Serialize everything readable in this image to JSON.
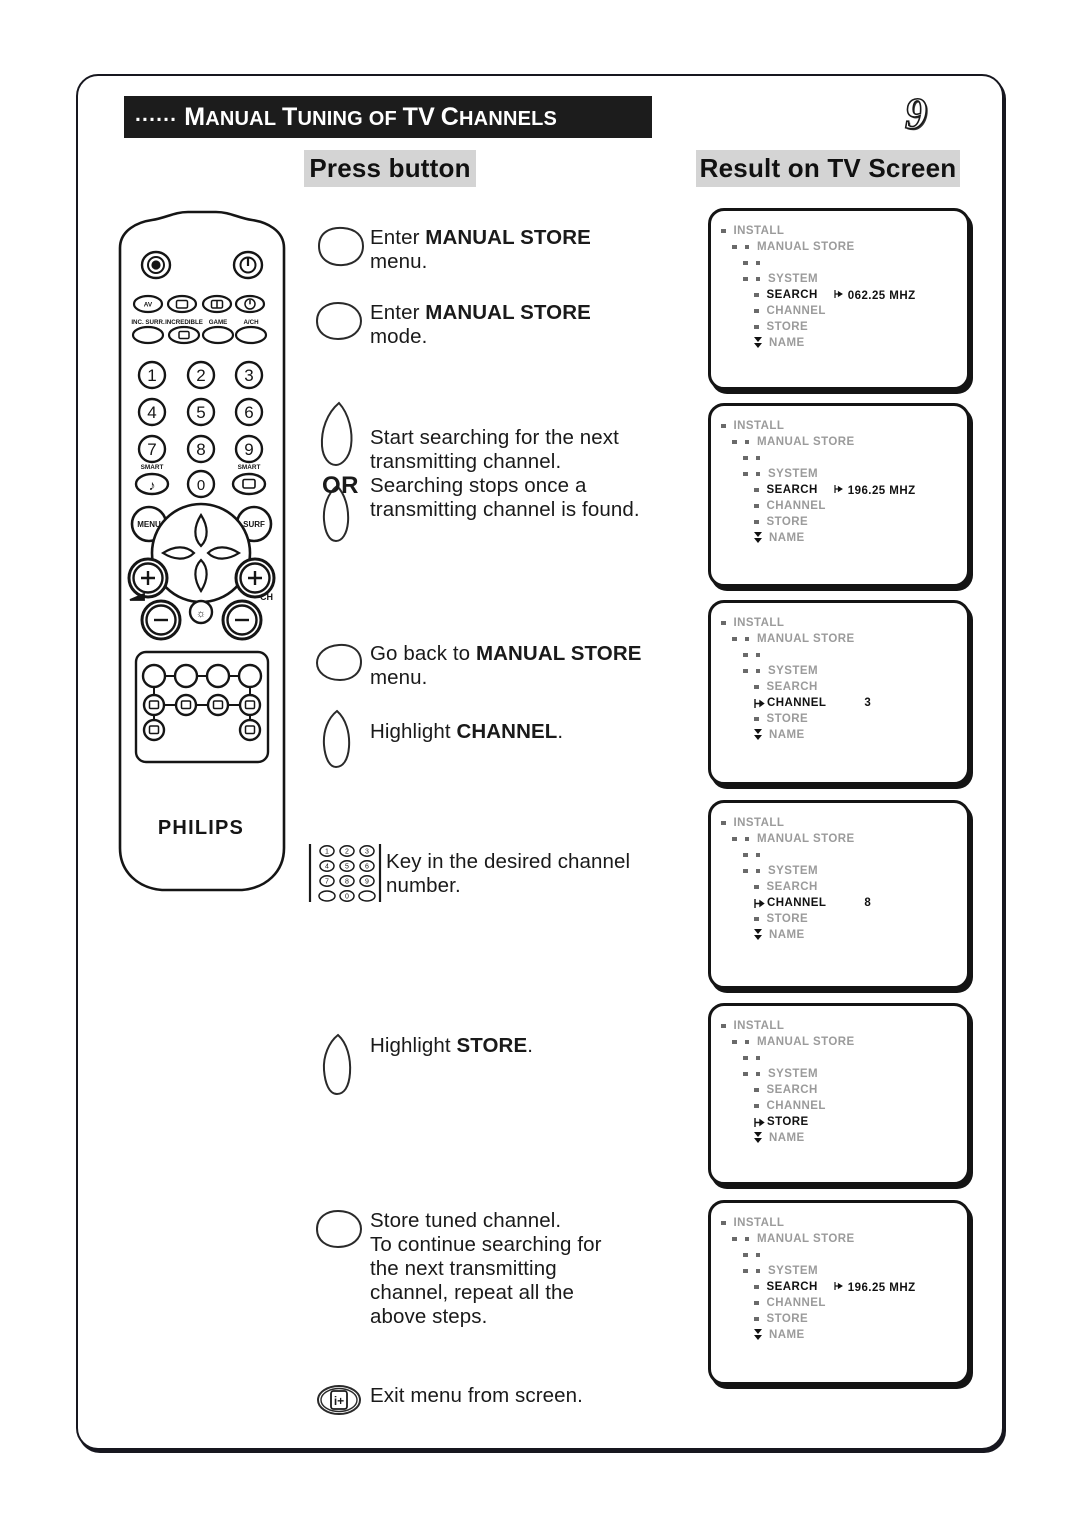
{
  "page": {
    "number": "9",
    "title_dots": "......",
    "title_parts": [
      {
        "big": "M",
        "rest": "ANUAL"
      },
      {
        "big": "T",
        "rest": "UNING"
      },
      {
        "big": "",
        "rest": "OF"
      },
      {
        "big": "TV",
        "rest": ""
      },
      {
        "big": "C",
        "rest": "HANNELS"
      }
    ],
    "title_plain": "...... MANUAL TUNING OF TV CHANNELS"
  },
  "columns": {
    "press_button": "Press button",
    "result_on_tv": "Result on TV Screen"
  },
  "remote": {
    "brand": "PHILIPS",
    "labels": {
      "inc_surr": "INC. SURR.",
      "incredible": "INCREDIBLE",
      "game": "GAME",
      "ach": "A/CH",
      "smart_left": "SMART",
      "smart_right": "SMART",
      "menu": "MENU",
      "surf": "SURF",
      "av": "AV",
      "ch": "CH"
    },
    "numbers": [
      "1",
      "2",
      "3",
      "4",
      "5",
      "6",
      "7",
      "8",
      "9",
      "0"
    ]
  },
  "steps": [
    {
      "id": "enter-manual-store-menu",
      "button_icon": "menu-teardrop-button",
      "lines": [
        {
          "pre": "Enter ",
          "bold": "MANUAL STORE",
          "post": ""
        },
        {
          "pre": "menu.",
          "bold": "",
          "post": ""
        }
      ]
    },
    {
      "id": "enter-manual-store-mode",
      "button_icon": "right-cursor-teardrop-button",
      "lines": [
        {
          "pre": "Enter ",
          "bold": "MANUAL STORE",
          "post": ""
        },
        {
          "pre": "mode.",
          "bold": "",
          "post": ""
        }
      ]
    },
    {
      "id": "start-searching",
      "button_icon": "up-cursor-teardrop-button",
      "button_icon_2": "down-cursor-teardrop-button",
      "or_label": "OR",
      "lines": [
        {
          "pre": "Start searching for the next",
          "bold": "",
          "post": ""
        },
        {
          "pre": "transmitting channel.",
          "bold": "",
          "post": ""
        },
        {
          "pre": "Searching stops once a",
          "bold": "",
          "post": ""
        },
        {
          "pre": "transmitting channel is found.",
          "bold": "",
          "post": ""
        }
      ]
    },
    {
      "id": "go-back-to-manual-store",
      "button_icon": "left-cursor-teardrop-button",
      "lines": [
        {
          "pre": "Go back to ",
          "bold": "MANUAL STORE",
          "post": ""
        },
        {
          "pre": "menu.",
          "bold": "",
          "post": ""
        }
      ]
    },
    {
      "id": "highlight-channel",
      "button_icon": "down-cursor-teardrop-button",
      "lines": [
        {
          "pre": "Highlight ",
          "bold": "CHANNEL",
          "post": "."
        }
      ]
    },
    {
      "id": "key-in-channel-number",
      "button_icon": "numeric-keypad-icon",
      "lines": [
        {
          "pre": "Key in the desired channel",
          "bold": "",
          "post": ""
        },
        {
          "pre": "number.",
          "bold": "",
          "post": ""
        }
      ]
    },
    {
      "id": "highlight-store",
      "button_icon": "down-cursor-teardrop-button",
      "lines": [
        {
          "pre": "Highlight ",
          "bold": "STORE",
          "post": "."
        }
      ]
    },
    {
      "id": "store-tuned-channel",
      "button_icon": "right-cursor-teardrop-button",
      "lines": [
        {
          "pre": "Store tuned channel.",
          "bold": "",
          "post": ""
        },
        {
          "pre": "To continue searching for",
          "bold": "",
          "post": ""
        },
        {
          "pre": "the next transmitting",
          "bold": "",
          "post": ""
        },
        {
          "pre": "channel, repeat all the",
          "bold": "",
          "post": ""
        },
        {
          "pre": "above steps.",
          "bold": "",
          "post": ""
        }
      ]
    },
    {
      "id": "exit-menu",
      "button_icon": "info-plus-button",
      "button_label": "i+",
      "lines": [
        {
          "pre": "Exit menu from screen.",
          "bold": "",
          "post": ""
        }
      ]
    }
  ],
  "tv_screens": [
    {
      "id": "screen-search-062",
      "rows": [
        {
          "label": "INSTALL",
          "indent": 0,
          "marker": "box",
          "selected": false,
          "value": ""
        },
        {
          "label": "MANUAL STORE",
          "indent": 1,
          "marker": "box2",
          "selected": false,
          "value": ""
        },
        {
          "label": "",
          "indent": 2,
          "marker": "box2",
          "selected": false,
          "value": ""
        },
        {
          "label": "SYSTEM",
          "indent": 2,
          "marker": "box2",
          "selected": false,
          "value": ""
        },
        {
          "label": "SEARCH",
          "indent": 3,
          "marker": "box",
          "selected": true,
          "value": "062.25 MHZ"
        },
        {
          "label": "CHANNEL",
          "indent": 3,
          "marker": "box",
          "selected": false,
          "value": ""
        },
        {
          "label": "STORE",
          "indent": 3,
          "marker": "box",
          "selected": false,
          "value": ""
        },
        {
          "label": "NAME",
          "indent": 3,
          "marker": "arrows",
          "selected": false,
          "value": ""
        }
      ]
    },
    {
      "id": "screen-search-196-a",
      "rows": [
        {
          "label": "INSTALL",
          "indent": 0,
          "marker": "box",
          "selected": false,
          "value": ""
        },
        {
          "label": "MANUAL STORE",
          "indent": 1,
          "marker": "box2",
          "selected": false,
          "value": ""
        },
        {
          "label": "",
          "indent": 2,
          "marker": "box2",
          "selected": false,
          "value": ""
        },
        {
          "label": "SYSTEM",
          "indent": 2,
          "marker": "box2",
          "selected": false,
          "value": ""
        },
        {
          "label": "SEARCH",
          "indent": 3,
          "marker": "box",
          "selected": true,
          "value": "196.25 MHZ"
        },
        {
          "label": "CHANNEL",
          "indent": 3,
          "marker": "box",
          "selected": false,
          "value": ""
        },
        {
          "label": "STORE",
          "indent": 3,
          "marker": "box",
          "selected": false,
          "value": ""
        },
        {
          "label": "NAME",
          "indent": 3,
          "marker": "arrows",
          "selected": false,
          "value": ""
        }
      ]
    },
    {
      "id": "screen-channel-3",
      "rows": [
        {
          "label": "INSTALL",
          "indent": 0,
          "marker": "box",
          "selected": false,
          "value": ""
        },
        {
          "label": "MANUAL STORE",
          "indent": 1,
          "marker": "box2",
          "selected": false,
          "value": ""
        },
        {
          "label": "",
          "indent": 2,
          "marker": "box2",
          "selected": false,
          "value": ""
        },
        {
          "label": "SYSTEM",
          "indent": 2,
          "marker": "box2",
          "selected": false,
          "value": ""
        },
        {
          "label": "SEARCH",
          "indent": 3,
          "marker": "box",
          "selected": false,
          "value": ""
        },
        {
          "label": "CHANNEL",
          "indent": 3,
          "marker": "cursor",
          "selected": true,
          "value": "3"
        },
        {
          "label": "STORE",
          "indent": 3,
          "marker": "box",
          "selected": false,
          "value": ""
        },
        {
          "label": "NAME",
          "indent": 3,
          "marker": "arrows",
          "selected": false,
          "value": ""
        }
      ]
    },
    {
      "id": "screen-channel-8",
      "rows": [
        {
          "label": "INSTALL",
          "indent": 0,
          "marker": "box",
          "selected": false,
          "value": ""
        },
        {
          "label": "MANUAL STORE",
          "indent": 1,
          "marker": "box2",
          "selected": false,
          "value": ""
        },
        {
          "label": "",
          "indent": 2,
          "marker": "box2",
          "selected": false,
          "value": ""
        },
        {
          "label": "SYSTEM",
          "indent": 2,
          "marker": "box2",
          "selected": false,
          "value": ""
        },
        {
          "label": "SEARCH",
          "indent": 3,
          "marker": "box",
          "selected": false,
          "value": ""
        },
        {
          "label": "CHANNEL",
          "indent": 3,
          "marker": "cursor",
          "selected": true,
          "value": "8"
        },
        {
          "label": "STORE",
          "indent": 3,
          "marker": "box",
          "selected": false,
          "value": ""
        },
        {
          "label": "NAME",
          "indent": 3,
          "marker": "arrows",
          "selected": false,
          "value": ""
        }
      ]
    },
    {
      "id": "screen-store",
      "rows": [
        {
          "label": "INSTALL",
          "indent": 0,
          "marker": "box",
          "selected": false,
          "value": ""
        },
        {
          "label": "MANUAL STORE",
          "indent": 1,
          "marker": "box2",
          "selected": false,
          "value": ""
        },
        {
          "label": "",
          "indent": 2,
          "marker": "box2",
          "selected": false,
          "value": ""
        },
        {
          "label": "SYSTEM",
          "indent": 2,
          "marker": "box2",
          "selected": false,
          "value": ""
        },
        {
          "label": "SEARCH",
          "indent": 3,
          "marker": "box",
          "selected": false,
          "value": ""
        },
        {
          "label": "CHANNEL",
          "indent": 3,
          "marker": "box",
          "selected": false,
          "value": ""
        },
        {
          "label": "STORE",
          "indent": 3,
          "marker": "cursor",
          "selected": true,
          "value": ""
        },
        {
          "label": "NAME",
          "indent": 3,
          "marker": "arrows",
          "selected": false,
          "value": ""
        }
      ]
    },
    {
      "id": "screen-search-196-b",
      "rows": [
        {
          "label": "INSTALL",
          "indent": 0,
          "marker": "box",
          "selected": false,
          "value": ""
        },
        {
          "label": "MANUAL STORE",
          "indent": 1,
          "marker": "box2",
          "selected": false,
          "value": ""
        },
        {
          "label": "",
          "indent": 2,
          "marker": "box2",
          "selected": false,
          "value": ""
        },
        {
          "label": "SYSTEM",
          "indent": 2,
          "marker": "box2",
          "selected": false,
          "value": ""
        },
        {
          "label": "SEARCH",
          "indent": 3,
          "marker": "box",
          "selected": true,
          "value": "196.25 MHZ"
        },
        {
          "label": "CHANNEL",
          "indent": 3,
          "marker": "box",
          "selected": false,
          "value": ""
        },
        {
          "label": "STORE",
          "indent": 3,
          "marker": "box",
          "selected": false,
          "value": ""
        },
        {
          "label": "NAME",
          "indent": 3,
          "marker": "arrows",
          "selected": false,
          "value": ""
        }
      ]
    }
  ],
  "colors": {
    "ink": "#1a1a1a",
    "menu_dim": "#9b9b9b",
    "menu_active": "#111111",
    "header_bg": "#d4d4d4",
    "title_bg": "#1c1c1c"
  }
}
